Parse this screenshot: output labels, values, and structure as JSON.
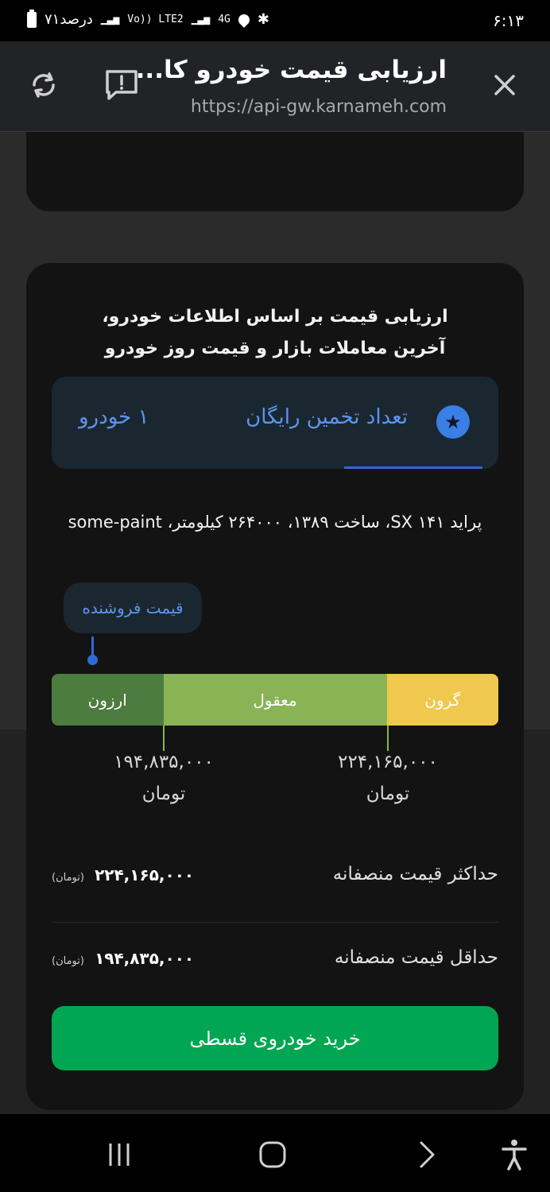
{
  "status_bar": {
    "time": "۶:۱۳",
    "battery_text": "۷۱درصد",
    "signal_text": "Vo)) LTE2",
    "network": "4G"
  },
  "browser": {
    "title": "ارزیابی قیمت خودرو کا...",
    "url": "https://api-gw.karnameh.com"
  },
  "card": {
    "intro": "ارزیابی قیمت بر اساس اطلاعات خودرو، آخرین معاملات بازار و قیمت روز خودرو",
    "free_estimates": {
      "label": "تعداد تخمین رایگان",
      "count": "۱ خودرو"
    },
    "car_description": "پراید ۱۴۱ SX، ساخت ۱۳۸۹، ۲۶۴۰۰۰ کیلومتر، some-paint",
    "seller_price_label": "قیمت فروشنده",
    "seller_price_position": 0.09,
    "price_bar": {
      "segments": [
        {
          "label": "ارزون",
          "fraction": 0.25,
          "color": "#4d7c3f"
        },
        {
          "label": "معقول",
          "fraction": 0.5,
          "color": "#8ab356"
        },
        {
          "label": "گرون",
          "fraction": 0.25,
          "color": "#f0c84e"
        }
      ],
      "min_tick": {
        "value": "۱۹۴,۸۳۵,۰۰۰",
        "currency": "تومان"
      },
      "max_tick": {
        "value": "۲۲۴,۱۶۵,۰۰۰",
        "currency": "تومان"
      }
    },
    "max_fair_price": {
      "label": "حداکثر قیمت منصفانه",
      "value": "۲۲۴,۱۶۵,۰۰۰",
      "unit": "(تومان)"
    },
    "min_fair_price": {
      "label": "حداقل قیمت منصفانه",
      "value": "۱۹۴,۸۳۵,۰۰۰",
      "unit": "(تومان)"
    },
    "buy_button": "خرید خودروی قسطی"
  },
  "colors": {
    "accent_blue": "#2e6ad6",
    "buy_green": "#00a651"
  }
}
